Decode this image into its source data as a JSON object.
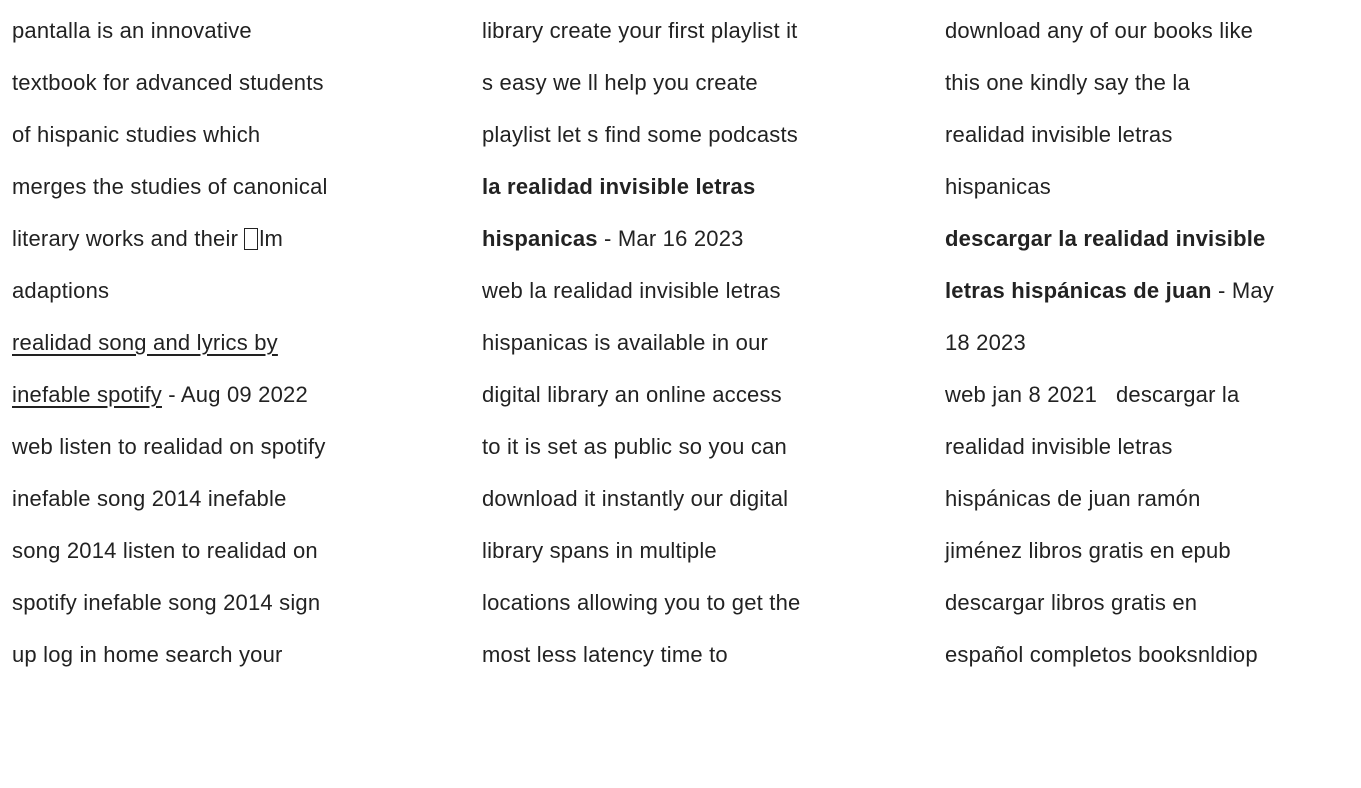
{
  "column_1": {
    "para_1": {
      "lines": [
        "pantalla is an innovative",
        "textbook for advanced students",
        "of hispanic studies which",
        "merges the studies of canonical",
        "literary works and their ",
        "adaptions"
      ],
      "line_5_after_glyph": "lm"
    },
    "result_1": {
      "link_line_1": "realidad song and lyrics by",
      "link_line_2": "inefable spotify",
      "date": " - Aug 09 2022",
      "lines": [
        "web listen to realidad on spotify",
        "inefable song 2014 inefable",
        "song 2014 listen to realidad on",
        "spotify inefable song 2014 sign",
        "up log in home search your"
      ]
    }
  },
  "column_2": {
    "para_1": {
      "lines": [
        "library create your first playlist it",
        "s easy we ll help you create",
        "playlist let s find some podcasts"
      ]
    },
    "result_1": {
      "title_line_1": "la realidad invisible letras",
      "title_line_2": "hispanicas",
      "date": " - Mar 16 2023",
      "lines": [
        "web la realidad invisible letras",
        "hispanicas is available in our",
        "digital library an online access",
        "to it is set as public so you can",
        "download it instantly our digital",
        "library spans in multiple",
        "locations allowing you to get the",
        "most less latency time to"
      ]
    }
  },
  "column_3": {
    "para_1": {
      "lines": [
        "download any of our books like",
        "this one kindly say the la",
        "realidad invisible letras",
        "hispanicas"
      ]
    },
    "result_1": {
      "title_line_1": "descargar la realidad invisible",
      "title_line_2": "letras hispánicas de juan",
      "date_line_1": " - May",
      "date_line_2": "18 2023",
      "lines": [
        "web jan 8 2021   descargar la",
        "realidad invisible letras",
        "hispánicas de juan ramón",
        "jiménez libros gratis en epub",
        "descargar libros gratis en",
        "español completos booksnldiop"
      ]
    }
  }
}
